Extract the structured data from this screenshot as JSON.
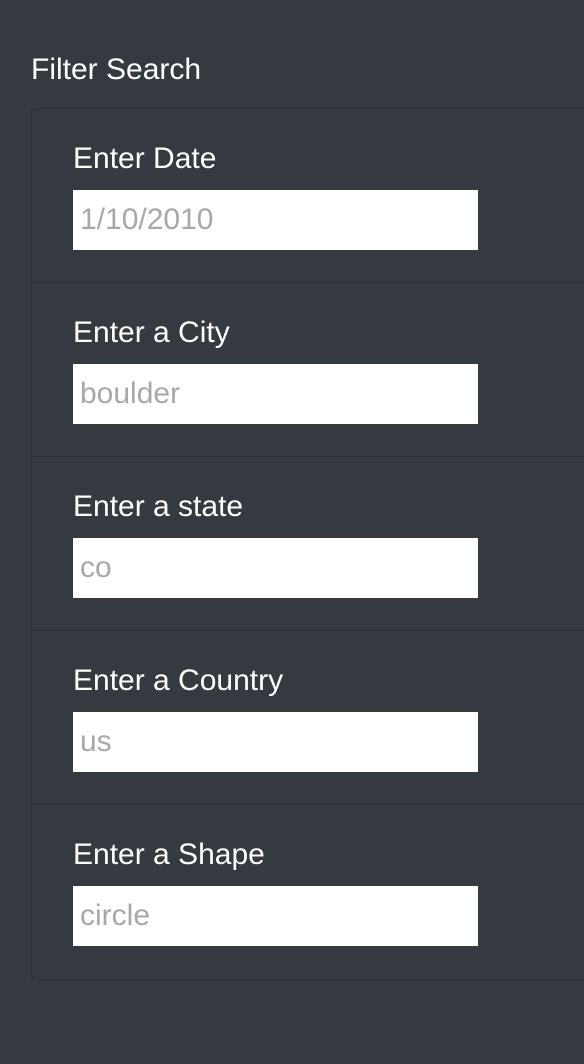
{
  "filter": {
    "title": "Filter Search",
    "fields": [
      {
        "label": "Enter Date",
        "placeholder": "1/10/2010",
        "value": ""
      },
      {
        "label": "Enter a City",
        "placeholder": "boulder",
        "value": ""
      },
      {
        "label": "Enter a state",
        "placeholder": "co",
        "value": ""
      },
      {
        "label": "Enter a Country",
        "placeholder": "us",
        "value": ""
      },
      {
        "label": "Enter a Shape",
        "placeholder": "circle",
        "value": ""
      }
    ]
  },
  "colors": {
    "background": "#343a40",
    "border": "#2b3035",
    "text": "#ffffff",
    "input_background": "#ffffff",
    "placeholder": "#a5a9ad"
  }
}
